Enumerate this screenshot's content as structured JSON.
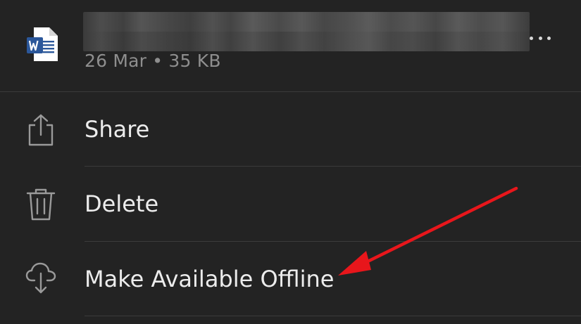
{
  "file": {
    "icon": "word-document-icon",
    "meta": "26 Mar • 35 KB"
  },
  "menu": {
    "items": [
      {
        "label": "Share",
        "icon": "share-icon"
      },
      {
        "label": "Delete",
        "icon": "trash-icon"
      },
      {
        "label": "Make Available Offline",
        "icon": "cloud-download-icon"
      }
    ]
  },
  "colors": {
    "background": "#232323",
    "text": "#ececec",
    "secondary_text": "#8e8e8e",
    "divider": "#3b3b3b",
    "word_blue": "#2b579a",
    "annotation_arrow": "#e8161b"
  }
}
